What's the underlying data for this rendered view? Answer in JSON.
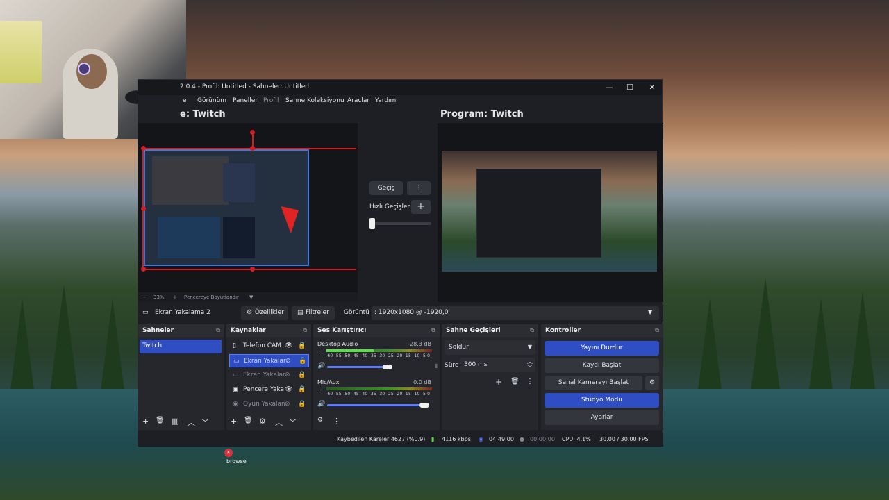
{
  "window": {
    "title": "2.0.4 - Profil: Untitled - Sahneler: Untitled",
    "minimize_icon": "—",
    "maximize_icon": "☐",
    "close_icon": "✕"
  },
  "menu": {
    "items": [
      "e",
      "Görünüm",
      "Paneller",
      "Profil",
      "Sahne Koleksiyonu",
      "Araçlar",
      "Yardım"
    ]
  },
  "preview": {
    "label": "e: Twitch",
    "zoom": "33%",
    "fit_label": "Pencereye Boyutlandır"
  },
  "transition": {
    "button": "Geçiş",
    "quick_label": "Hızlı Geçişler"
  },
  "program": {
    "label": "Program: Twitch"
  },
  "source_bar": {
    "source_name": "Ekran Yakalama 2",
    "properties": "Özellikler",
    "filters": "Filtreler",
    "display_label": "Görüntü",
    "display_value": ": 1920x1080 @ -1920,0"
  },
  "scenes": {
    "title": "Sahneler",
    "items": [
      "Twitch"
    ]
  },
  "sources": {
    "title": "Kaynaklar",
    "items": [
      {
        "label": "Telefon CAM"
      },
      {
        "label": "Ekran Yakalar"
      },
      {
        "label": "Ekran Yakalar"
      },
      {
        "label": "Pencere Yaka"
      },
      {
        "label": "Oyun Yakalan"
      }
    ]
  },
  "mixer": {
    "title": "Ses Karıştırıcı",
    "scale": "-60 -55 -50 -45 -40 -35 -30 -25 -20 -15 -10 -5 0",
    "channels": [
      {
        "name": "Desktop Audio",
        "db": "-28.3 dB",
        "level": 0.45,
        "volume": 0.62
      },
      {
        "name": "Mic/Aux",
        "db": "0.0 dB",
        "level": 0.0,
        "volume": 1.0
      }
    ]
  },
  "transitions_dock": {
    "title": "Sahne Geçişleri",
    "type": "Soldur",
    "duration_label": "Süre",
    "duration_value": "300 ms"
  },
  "controls": {
    "title": "Kontroller",
    "buttons": [
      "Yayını Durdur",
      "Kaydı Başlat",
      "Sanal Kamerayı Başlat",
      "Stüdyo Modu",
      "Ayarlar"
    ]
  },
  "status": {
    "dropped": "Kaybedilen Kareler 4627 (%0.9)",
    "bitrate": "4116 kbps",
    "live_time": "04:49:00",
    "rec_time": "00:00:00",
    "cpu": "CPU: 4.1%",
    "fps": "30.00 / 30.00 FPS"
  },
  "desktop": {
    "icon_label": "browse"
  },
  "colors": {
    "accent": "#2f4ec4",
    "panel": "#25272d",
    "red_guides": "#d31d25"
  }
}
